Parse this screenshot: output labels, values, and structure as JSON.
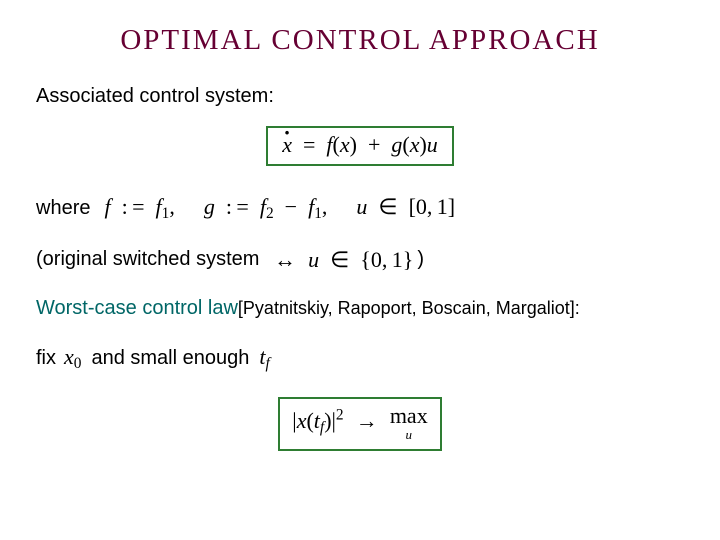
{
  "title": "OPTIMAL  CONTROL  APPROACH",
  "lines": {
    "assoc": "Associated control system:",
    "where": "where",
    "orig_pre": "(original switched system",
    "orig_post": ")",
    "wccl": "Worst-case control law",
    "refs": " [Pyatnitskiy, Rapoport, Boscain, Margaliot]:",
    "fix": "fix",
    "and_small": "and small enough"
  },
  "math": {
    "state_eq": {
      "lhs_var": "x",
      "f": "f",
      "g": "g",
      "arg": "x",
      "u": "u"
    },
    "defs": {
      "f_lhs": "f",
      "f_rhs_base": "f",
      "f_rhs_sub": "1",
      "g_lhs": "g",
      "g_rhs_a_base": "f",
      "g_rhs_a_sub": "2",
      "g_rhs_b_base": "f",
      "g_rhs_b_sub": "1",
      "u": "u",
      "interval_lo": "0",
      "interval_hi": "1"
    },
    "orig": {
      "u": "u",
      "set_a": "0",
      "set_b": "1"
    },
    "x0": {
      "var": "x",
      "sub": "0"
    },
    "tf": {
      "var": "t",
      "sub": "f"
    },
    "obj": {
      "var": "x",
      "arg_var": "t",
      "arg_sub": "f",
      "exp": "2",
      "op": "max",
      "sub": "u"
    }
  }
}
